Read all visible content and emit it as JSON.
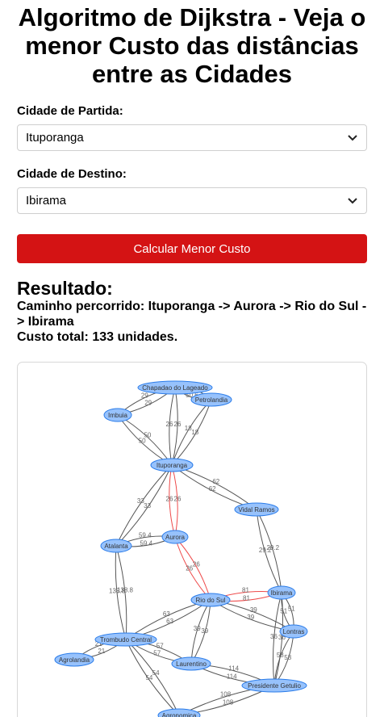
{
  "title": "Algoritmo de Dijkstra - Veja o menor Custo das distâncias entre as Cidades",
  "form": {
    "origin_label": "Cidade de Partida:",
    "origin_value": "Ituporanga",
    "destination_label": "Cidade de Destino:",
    "destination_value": "Ibirama",
    "submit_label": "Calcular Menor Custo"
  },
  "result": {
    "heading": "Resultado:",
    "path_text": "Caminho percorrido: Ituporanga -> Aurora -> Rio do Sul -> Ibirama",
    "cost_text": "Custo total: 133 unidades."
  },
  "colors": {
    "button": "#d41314",
    "node_fill": "#97c2fc",
    "node_border": "#2b7ce9",
    "path_edge": "#ee4a4a",
    "edge": "#555555"
  },
  "graph": {
    "nodes": [
      {
        "id": "chapadao",
        "label": "Chapadao do Lageado"
      },
      {
        "id": "petrolandia",
        "label": "Petrolandia"
      },
      {
        "id": "imbuia",
        "label": "Imbuia"
      },
      {
        "id": "ituporanga",
        "label": "Ituporanga"
      },
      {
        "id": "vidal",
        "label": "Vidal Ramos"
      },
      {
        "id": "aurora",
        "label": "Aurora"
      },
      {
        "id": "atalanta",
        "label": "Atalanta"
      },
      {
        "id": "riodosul",
        "label": "Rio do Sul"
      },
      {
        "id": "ibirama",
        "label": "Ibirama"
      },
      {
        "id": "lontras",
        "label": "Lontras"
      },
      {
        "id": "trombudo",
        "label": "Trombudo Central"
      },
      {
        "id": "agrolandia",
        "label": "Agrolandia"
      },
      {
        "id": "laurentino",
        "label": "Laurentino"
      },
      {
        "id": "getulio",
        "label": "Presidente Getulio"
      },
      {
        "id": "agronomica",
        "label": "Agronomica"
      }
    ],
    "edges": [
      {
        "from": "chapadao",
        "to": "petrolandia",
        "weight": "50.6",
        "path": false
      },
      {
        "from": "chapadao",
        "to": "imbuia",
        "weight": "29",
        "path": false
      },
      {
        "from": "chapadao",
        "to": "ituporanga",
        "weight": "26",
        "path": false
      },
      {
        "from": "petrolandia",
        "to": "ituporanga",
        "weight": "18",
        "path": false
      },
      {
        "from": "imbuia",
        "to": "ituporanga",
        "weight": "50",
        "path": false
      },
      {
        "from": "ituporanga",
        "to": "vidal",
        "weight": "62",
        "path": false
      },
      {
        "from": "ituporanga",
        "to": "atalanta",
        "weight": "33",
        "path": false
      },
      {
        "from": "ituporanga",
        "to": "aurora",
        "weight": "26",
        "path": true
      },
      {
        "from": "atalanta",
        "to": "aurora",
        "weight": "59.4",
        "path": false
      },
      {
        "from": "aurora",
        "to": "riodosul",
        "weight": "26",
        "path": true
      },
      {
        "from": "vidal",
        "to": "ibirama",
        "weight": "29.2",
        "path": false
      },
      {
        "from": "riodosul",
        "to": "ibirama",
        "weight": "81",
        "path": true
      },
      {
        "from": "riodosul",
        "to": "lontras",
        "weight": "39",
        "path": false
      },
      {
        "from": "riodosul",
        "to": "trombudo",
        "weight": "63",
        "path": false
      },
      {
        "from": "riodosul",
        "to": "laurentino",
        "weight": "39",
        "path": false
      },
      {
        "from": "ibirama",
        "to": "lontras",
        "weight": "51",
        "path": false
      },
      {
        "from": "ibirama",
        "to": "getulio",
        "weight": "36",
        "path": false
      },
      {
        "from": "lontras",
        "to": "getulio",
        "weight": "58",
        "path": false
      },
      {
        "from": "atalanta",
        "to": "trombudo",
        "weight": "138.8",
        "path": false
      },
      {
        "from": "trombudo",
        "to": "agrolandia",
        "weight": "21",
        "path": false
      },
      {
        "from": "trombudo",
        "to": "laurentino",
        "weight": "57",
        "path": false
      },
      {
        "from": "trombudo",
        "to": "agronomica",
        "weight": "54",
        "path": false
      },
      {
        "from": "laurentino",
        "to": "getulio",
        "weight": "114",
        "path": false
      },
      {
        "from": "getulio",
        "to": "agronomica",
        "weight": "108",
        "path": false
      }
    ]
  }
}
